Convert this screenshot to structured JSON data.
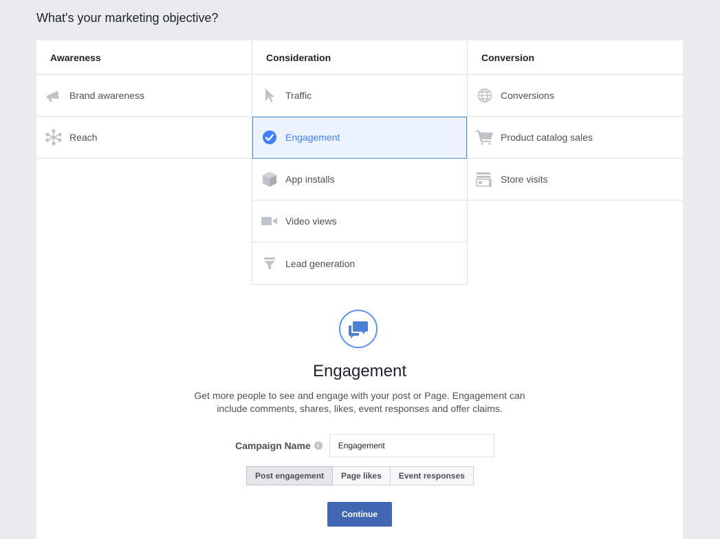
{
  "page": {
    "title": "What's your marketing objective?"
  },
  "columns": {
    "awareness": {
      "heading": "Awareness",
      "items": [
        {
          "label": "Brand awareness",
          "icon": "megaphone-icon"
        },
        {
          "label": "Reach",
          "icon": "reach-icon"
        }
      ]
    },
    "consideration": {
      "heading": "Consideration",
      "items": [
        {
          "label": "Traffic",
          "icon": "cursor-icon"
        },
        {
          "label": "Engagement",
          "icon": "check-circle-icon",
          "selected": true
        },
        {
          "label": "App installs",
          "icon": "box-icon"
        },
        {
          "label": "Video views",
          "icon": "video-camera-icon"
        },
        {
          "label": "Lead generation",
          "icon": "funnel-icon"
        }
      ]
    },
    "conversion": {
      "heading": "Conversion",
      "items": [
        {
          "label": "Conversions",
          "icon": "globe-icon"
        },
        {
          "label": "Product catalog sales",
          "icon": "cart-icon"
        },
        {
          "label": "Store visits",
          "icon": "store-icon"
        }
      ]
    }
  },
  "objective": {
    "title": "Engagement",
    "description": "Get more people to see and engage with your post or Page. Engagement can include comments, shares, likes, event responses and offer claims.",
    "icon": "chat-bubbles-icon"
  },
  "campaign": {
    "label": "Campaign Name",
    "value": "Engagement"
  },
  "engagement_types": {
    "post": "Post engagement",
    "page_likes": "Page likes",
    "event_responses": "Event responses",
    "selected": "Post engagement"
  },
  "continue_label": "Continue",
  "colors": {
    "accent": "#4080ff",
    "primary_button": "#4267b2",
    "background": "#e9ebee",
    "icon_gray": "#bec3c9"
  }
}
